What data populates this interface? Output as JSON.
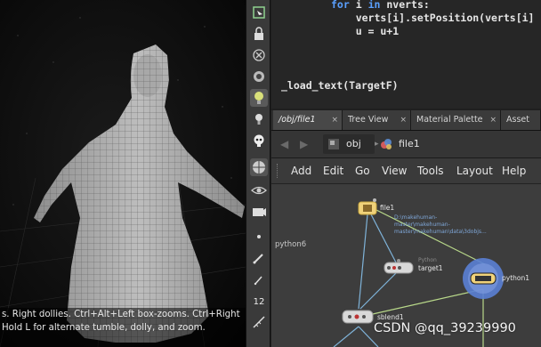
{
  "viewport": {
    "hint_line1": "s. Right dollies. Ctrl+Alt+Left box-zooms. Ctrl+Right",
    "hint_line2": "Hold L for alternate tumble, dolly, and zoom."
  },
  "side_label": "python6",
  "code": {
    "line1_kw1": "for",
    "line1_var": " i ",
    "line1_kw2": "in",
    "line1_rest": " nverts:",
    "line2": "    verts[i].setPosition(verts[i]",
    "line3": "    u = u+1",
    "line4": "_load_text(TargetF)"
  },
  "tabs": [
    {
      "label": "/obj/file1",
      "close": "×",
      "active": true
    },
    {
      "label": "Tree View",
      "close": "×",
      "active": false
    },
    {
      "label": "Material Palette",
      "close": "×",
      "active": false
    },
    {
      "label": "Asset Bro",
      "close": "",
      "active": false
    }
  ],
  "path": {
    "level1": "obj",
    "level2": "file1",
    "back": "◀",
    "forward": "▶"
  },
  "menu": [
    "Add",
    "Edit",
    "Go",
    "View",
    "Tools",
    "Layout",
    "Help"
  ],
  "nodes": {
    "file1": {
      "name": "file1",
      "path": "D:\\makehuman-\nmaster\\makehuman-\nmaster\\makehuman\\data\\3dobjs..."
    },
    "target1": {
      "name": "target1",
      "type": "Python"
    },
    "python1": {
      "name": "python1"
    },
    "sblend1": {
      "name": "sblend1"
    }
  },
  "shelf_number": "12",
  "watermark": "CSDN @qq_39239990",
  "colors": {
    "bg": "#3d3d3d",
    "node_selected": "#f0d27a",
    "python_glow": "#5a7fd4",
    "wire_blue": "#7fb3d9",
    "wire_green": "#b9d98a",
    "keyword": "#5aa0ff"
  }
}
